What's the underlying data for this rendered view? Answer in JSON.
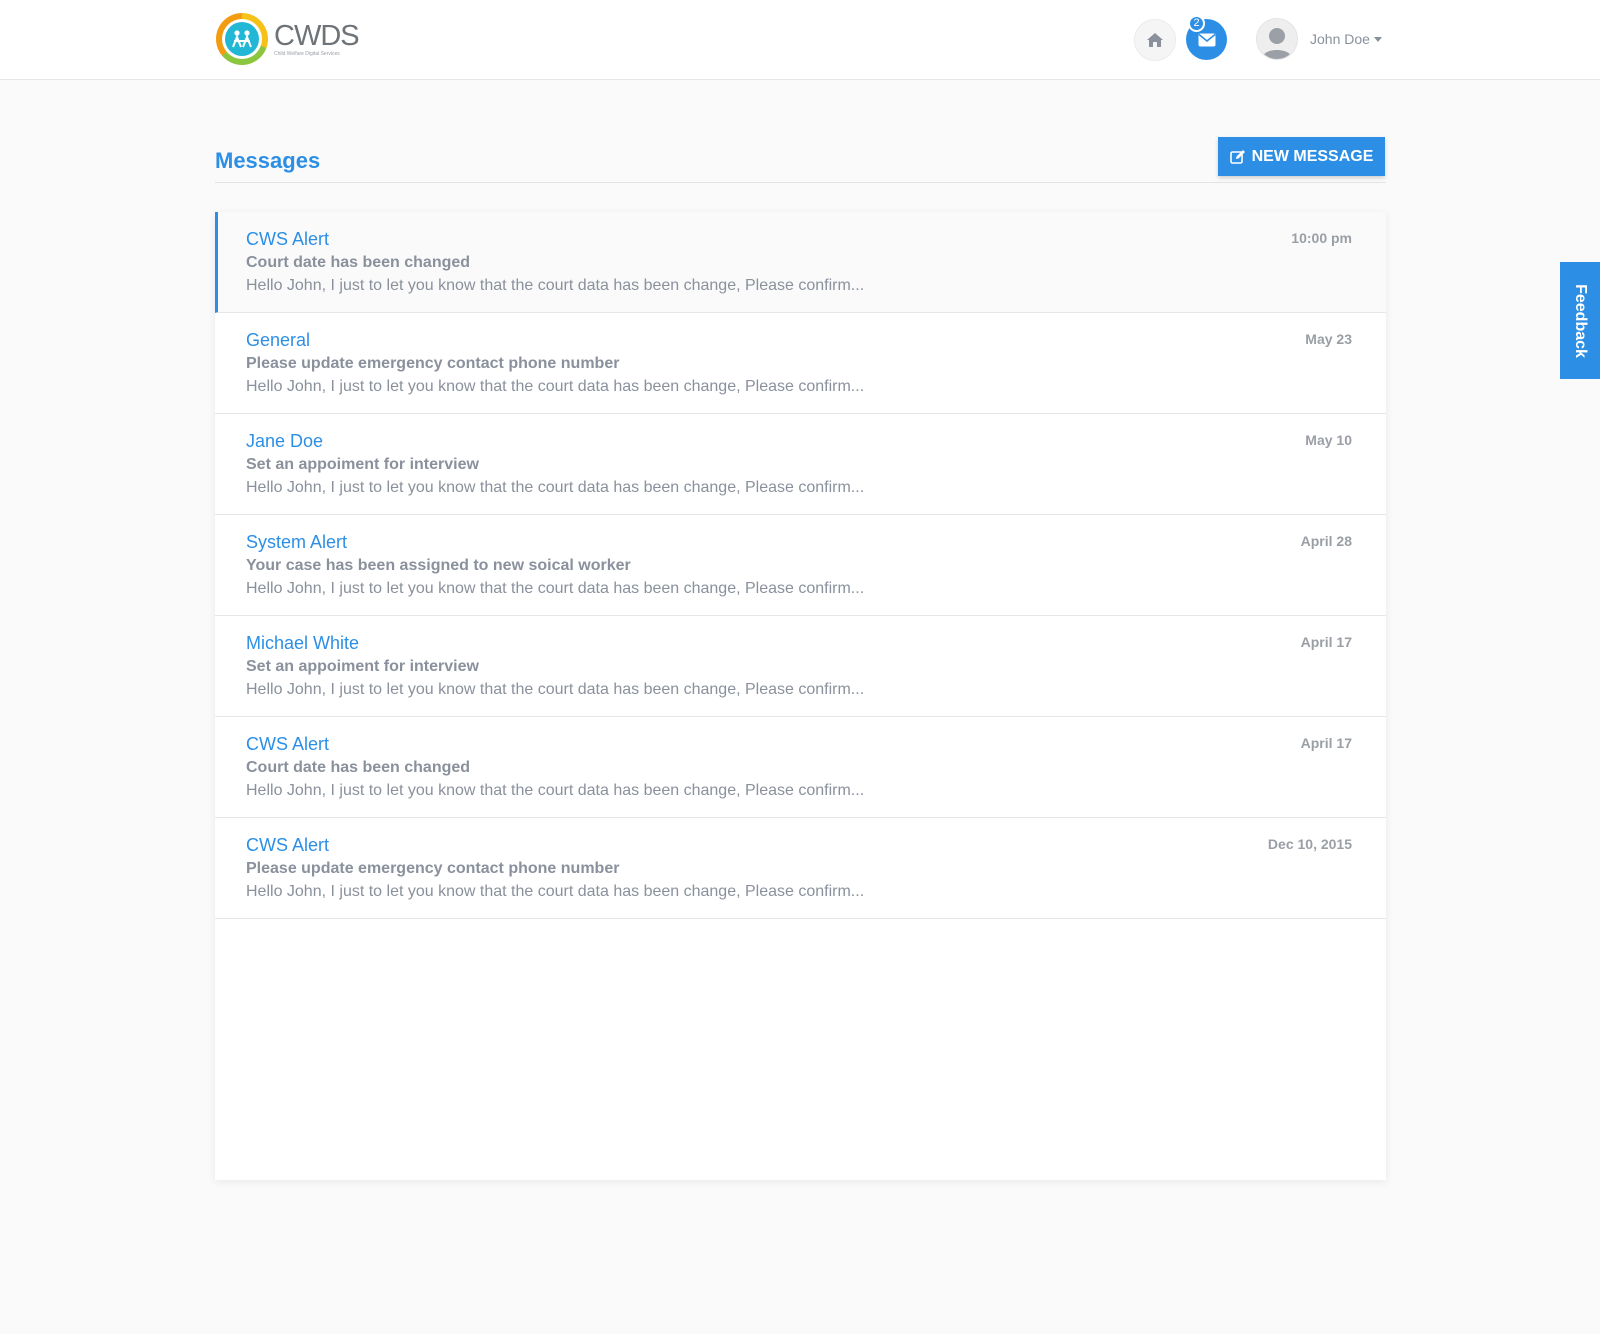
{
  "brand": {
    "name": "CWDS",
    "tagline": "Child Welfare Digital Services"
  },
  "header": {
    "mail_badge_count": "2",
    "user_name": "John Doe"
  },
  "icons": {
    "home": "home-icon",
    "mail": "envelope-icon",
    "user": "user-avatar-icon",
    "edit": "edit-icon",
    "caret": "caret-down-icon"
  },
  "colors": {
    "accent": "#2c8fe5",
    "text_muted": "#8a919c",
    "page_bg": "#fafafa"
  },
  "main": {
    "title": "Messages",
    "new_message_label": "NEW MESSAGE",
    "messages": [
      {
        "sender": "CWS Alert",
        "subject": "Court date has been changed",
        "preview": "Hello John, I just to let you know that the court data has been change, Please confirm...",
        "date": "10:00 pm",
        "active": true
      },
      {
        "sender": "General",
        "subject": "Please update emergency contact phone number",
        "preview": "Hello John, I just to let you know that the court data has been change, Please confirm...",
        "date": "May 23",
        "active": false
      },
      {
        "sender": "Jane Doe",
        "subject": "Set an appoiment for interview",
        "preview": "Hello John, I just to let you know that the court data has been change, Please confirm...",
        "date": "May 10",
        "active": false
      },
      {
        "sender": "System Alert",
        "subject": "Your case has been assigned to new soical worker",
        "preview": "Hello John, I just to let you know that the court data has been change, Please confirm...",
        "date": "April 28",
        "active": false
      },
      {
        "sender": "Michael White",
        "subject": "Set an appoiment for interview",
        "preview": "Hello John, I just to let you know that the court data has been change, Please confirm...",
        "date": "April 17",
        "active": false
      },
      {
        "sender": "CWS Alert",
        "subject": "Court date has been changed",
        "preview": "Hello John, I just to let you know that the court data has been change, Please confirm...",
        "date": "April 17",
        "active": false
      },
      {
        "sender": "CWS Alert",
        "subject": "Please update emergency contact phone number",
        "preview": "Hello John, I just to let you know that the court data has been change, Please confirm...",
        "date": "Dec 10, 2015",
        "active": false
      }
    ]
  },
  "feedback": {
    "label": "Feedback"
  }
}
